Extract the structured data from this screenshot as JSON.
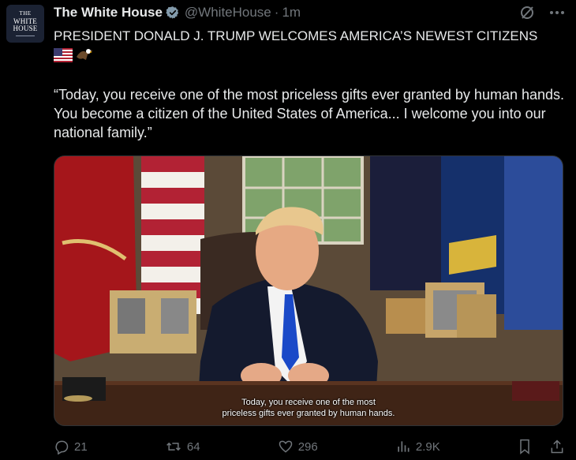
{
  "account": {
    "avatar_small": "THE",
    "avatar_line1": "WHITE",
    "avatar_line2": "HOUSE",
    "name": "The White House",
    "handle": "@WhiteHouse",
    "separator": "·",
    "time": "1m"
  },
  "post": {
    "headline": "PRESIDENT DONALD J. TRUMP WELCOMES AMERICA’S NEWEST CITIZENS",
    "emojis": [
      "us-flag",
      "eagle"
    ],
    "quote": "“Today, you receive one of the most priceless gifts ever granted by human hands. You become a citizen of the United States of America... I welcome you into our national family.”"
  },
  "video": {
    "caption_line1": "Today, you receive one of the most",
    "caption_line2": "priceless gifts ever granted by human hands."
  },
  "actions": {
    "replies": "21",
    "reposts": "64",
    "likes": "296",
    "views": "2.9K"
  },
  "icons": [
    "verified-badge-icon",
    "grok-icon",
    "more-icon",
    "reply-icon",
    "repost-icon",
    "like-icon",
    "views-icon",
    "bookmark-icon",
    "share-icon"
  ],
  "colors": {
    "background": "#000000",
    "text": "#e7e9ea",
    "muted": "#71767b"
  }
}
